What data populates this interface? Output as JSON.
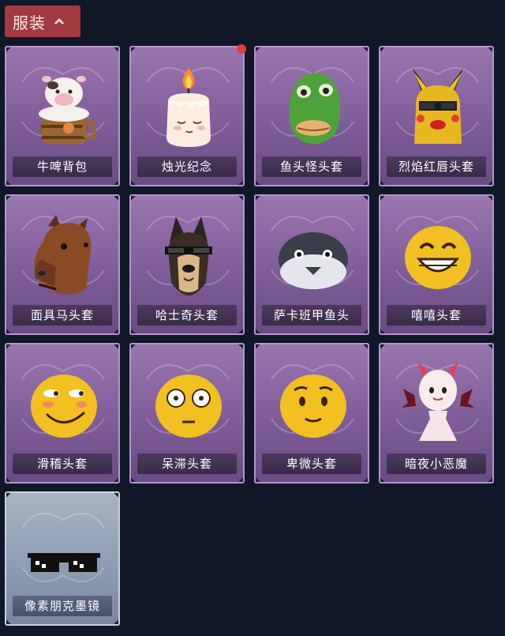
{
  "header": {
    "title": "服装",
    "chevron_icon": "chevron-up-icon"
  },
  "items": [
    {
      "label": "牛啤背包",
      "icon": "cow-beer-backpack-icon",
      "new": false
    },
    {
      "label": "烛光纪念",
      "icon": "candle-icon",
      "new": true
    },
    {
      "label": "鱼头怪头套",
      "icon": "fish-head-mask-icon",
      "new": false
    },
    {
      "label": "烈焰红唇头套",
      "icon": "red-lips-pikachu-mask-icon",
      "new": false
    },
    {
      "label": "面具马头套",
      "icon": "horse-mask-icon",
      "new": false
    },
    {
      "label": "哈士奇头套",
      "icon": "husky-mask-icon",
      "new": false
    },
    {
      "label": "萨卡班甲鱼头",
      "icon": "sacabambaspis-head-icon",
      "new": false
    },
    {
      "label": "嘻嘻头套",
      "icon": "grin-emoji-mask-icon",
      "new": false
    },
    {
      "label": "滑稽头套",
      "icon": "funny-emoji-mask-icon",
      "new": false
    },
    {
      "label": "呆滞头套",
      "icon": "dazed-emoji-mask-icon",
      "new": false
    },
    {
      "label": "卑微头套",
      "icon": "humble-emoji-mask-icon",
      "new": false
    },
    {
      "label": "暗夜小恶魔",
      "icon": "little-devil-icon",
      "new": false
    },
    {
      "label": "像素朋克墨镜",
      "icon": "pixel-sunglasses-icon",
      "new": false
    }
  ],
  "colors": {
    "background": "#101828",
    "header": "#a23a3f",
    "card_purple": "#8a68a4",
    "card_silver": "#98a5b8",
    "badge": "#e53a3a",
    "emoji_yellow": "#f2c020"
  }
}
